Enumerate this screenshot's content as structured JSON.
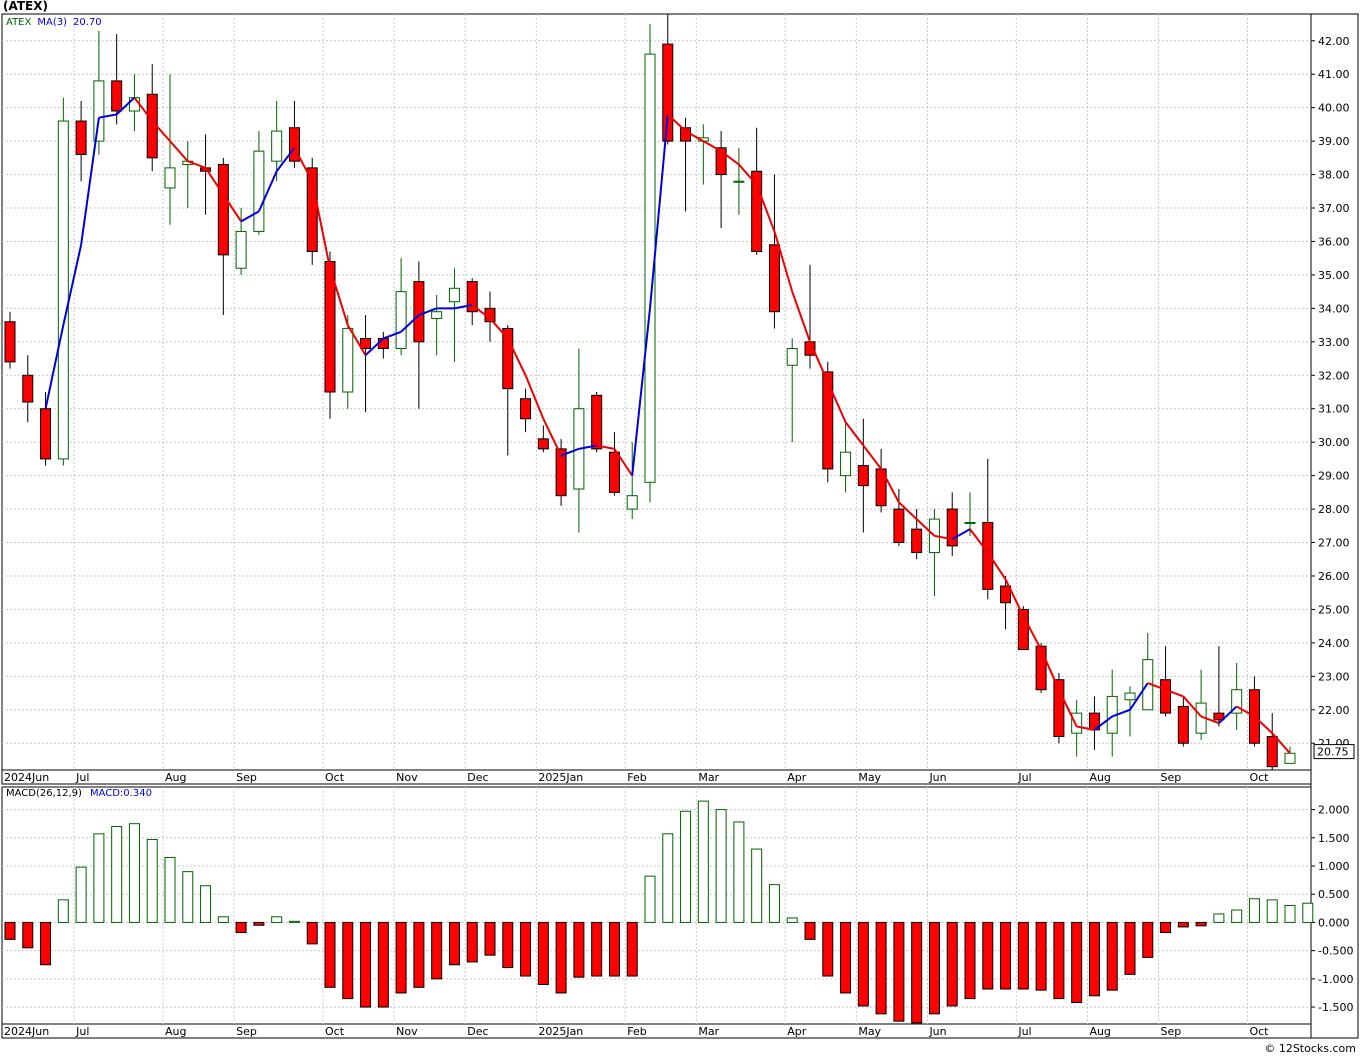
{
  "title": "(ATEX)",
  "footer": "© 12Stocks.com",
  "colors": {
    "up": "#006400",
    "down": "#ff0000",
    "ma_up": "#0000dd",
    "ma_down": "#ee0000",
    "grid": "#c8c8c8",
    "axis": "#000000"
  },
  "chart_data": [
    {
      "type": "candlestick",
      "legend": {
        "symbol": "ATEX",
        "ma_label": "MA(3)",
        "ma_value": "20.70"
      },
      "last_price": "20.75",
      "ylim": [
        20.2,
        42.8
      ],
      "y_ticks": [
        "42.00",
        "41.00",
        "40.00",
        "39.00",
        "38.00",
        "37.00",
        "36.00",
        "35.00",
        "34.00",
        "33.00",
        "32.00",
        "31.00",
        "30.00",
        "29.00",
        "28.00",
        "27.00",
        "26.00",
        "25.00",
        "24.00",
        "23.00",
        "22.00",
        "21.00"
      ],
      "x_labels": [
        "2024Jun",
        "Jul",
        "Aug",
        "Sep",
        "Oct",
        "Nov",
        "Dec",
        "2025Jan",
        "Feb",
        "Mar",
        "Apr",
        "May",
        "Jun",
        "Jul",
        "Aug",
        "Sep",
        "Oct"
      ],
      "x_label_index": [
        0,
        4,
        9,
        13,
        18,
        22,
        26,
        30,
        35,
        39,
        44,
        48,
        52,
        57,
        61,
        65,
        70
      ],
      "candles": [
        [
          33.6,
          33.9,
          32.2,
          32.4
        ],
        [
          32.0,
          32.6,
          30.6,
          31.2
        ],
        [
          31.0,
          31.5,
          29.3,
          29.5
        ],
        [
          29.5,
          40.3,
          29.3,
          39.6
        ],
        [
          39.6,
          40.2,
          37.8,
          38.6
        ],
        [
          39.0,
          42.3,
          38.6,
          40.8
        ],
        [
          40.8,
          42.2,
          39.5,
          39.9
        ],
        [
          39.9,
          41.0,
          39.3,
          40.3
        ],
        [
          40.4,
          41.3,
          38.1,
          38.5
        ],
        [
          37.6,
          41.0,
          36.5,
          38.2
        ],
        [
          38.3,
          39.0,
          37.0,
          38.4
        ],
        [
          38.2,
          39.2,
          36.8,
          38.1
        ],
        [
          38.3,
          38.5,
          33.8,
          35.6
        ],
        [
          35.2,
          37.0,
          35.0,
          36.3
        ],
        [
          36.3,
          39.3,
          36.2,
          38.7
        ],
        [
          38.4,
          40.2,
          37.8,
          39.3
        ],
        [
          39.4,
          40.2,
          38.2,
          38.4
        ],
        [
          38.2,
          38.5,
          35.3,
          35.7
        ],
        [
          35.4,
          35.7,
          30.7,
          31.5
        ],
        [
          31.5,
          33.8,
          31.0,
          33.4
        ],
        [
          33.1,
          33.8,
          30.9,
          32.8
        ],
        [
          33.1,
          33.3,
          32.5,
          32.8
        ],
        [
          32.8,
          35.5,
          32.6,
          34.5
        ],
        [
          34.8,
          35.4,
          31.0,
          33.0
        ],
        [
          33.7,
          34.4,
          32.6,
          33.9
        ],
        [
          34.2,
          35.2,
          32.4,
          34.6
        ],
        [
          34.8,
          34.9,
          33.5,
          33.9
        ],
        [
          34.0,
          34.5,
          33.0,
          33.6
        ],
        [
          33.4,
          33.5,
          29.6,
          31.6
        ],
        [
          31.3,
          31.6,
          30.3,
          30.7
        ],
        [
          30.1,
          30.5,
          29.7,
          29.8
        ],
        [
          29.8,
          30.1,
          28.1,
          28.4
        ],
        [
          28.6,
          32.8,
          27.3,
          31.0
        ],
        [
          31.4,
          31.5,
          29.7,
          29.8
        ],
        [
          29.7,
          30.3,
          28.4,
          28.5
        ],
        [
          28.0,
          30.0,
          27.7,
          28.4
        ],
        [
          28.8,
          42.5,
          28.2,
          41.6
        ],
        [
          41.9,
          42.8,
          38.9,
          39.0
        ],
        [
          39.4,
          39.7,
          36.9,
          39.0
        ],
        [
          39.0,
          39.5,
          37.7,
          39.1
        ],
        [
          38.8,
          39.3,
          36.4,
          38.0
        ],
        [
          37.8,
          38.8,
          36.8,
          37.8
        ],
        [
          38.1,
          39.4,
          35.6,
          35.7
        ],
        [
          35.9,
          38.0,
          33.4,
          33.9
        ],
        [
          32.3,
          33.1,
          30.0,
          32.8
        ],
        [
          33.0,
          35.3,
          32.2,
          32.6
        ],
        [
          32.1,
          32.4,
          28.8,
          29.2
        ],
        [
          29.0,
          30.6,
          28.5,
          29.7
        ],
        [
          29.3,
          30.7,
          27.3,
          28.7
        ],
        [
          29.2,
          29.8,
          27.9,
          28.1
        ],
        [
          28.0,
          28.6,
          26.9,
          27.0
        ],
        [
          27.4,
          28.0,
          26.5,
          26.7
        ],
        [
          26.7,
          28.0,
          25.4,
          27.7
        ],
        [
          28.0,
          28.5,
          26.6,
          26.9
        ],
        [
          27.6,
          28.5,
          27.2,
          27.6
        ],
        [
          27.6,
          29.5,
          25.3,
          25.6
        ],
        [
          25.7,
          26.0,
          24.4,
          25.2
        ],
        [
          25.0,
          25.1,
          23.9,
          23.8
        ],
        [
          23.9,
          24.0,
          22.5,
          22.6
        ],
        [
          22.9,
          23.1,
          21.0,
          21.2
        ],
        [
          21.3,
          22.3,
          20.6,
          21.9
        ],
        [
          21.9,
          22.4,
          20.8,
          21.4
        ],
        [
          21.3,
          23.2,
          20.6,
          22.4
        ],
        [
          22.3,
          22.7,
          21.2,
          22.5
        ],
        [
          22.0,
          24.3,
          22.1,
          23.5
        ],
        [
          22.9,
          23.9,
          21.8,
          21.9
        ],
        [
          22.1,
          22.4,
          20.9,
          21.0
        ],
        [
          21.3,
          23.2,
          21.1,
          22.2
        ],
        [
          21.9,
          23.9,
          21.5,
          21.7
        ],
        [
          21.9,
          23.4,
          21.4,
          22.6
        ],
        [
          22.6,
          23.0,
          20.9,
          21.0
        ],
        [
          21.2,
          21.9,
          20.2,
          20.3
        ],
        [
          20.4,
          20.9,
          20.4,
          20.7
        ]
      ],
      "ma": [
        null,
        null,
        31.0,
        33.5,
        35.9,
        39.7,
        39.8,
        40.3,
        39.6,
        39.0,
        38.4,
        38.2,
        37.4,
        36.6,
        36.9,
        38.1,
        38.8,
        37.8,
        35.2,
        33.5,
        32.6,
        33.1,
        33.3,
        33.8,
        34.0,
        34.0,
        34.1,
        33.7,
        33.1,
        32.0,
        30.7,
        29.6,
        29.8,
        29.9,
        29.8,
        29.0,
        34.0,
        39.8,
        39.3,
        39.0,
        38.7,
        38.3,
        37.7,
        36.3,
        34.5,
        33.0,
        31.8,
        30.6,
        29.9,
        29.2,
        28.2,
        27.7,
        27.2,
        27.1,
        27.4,
        26.7,
        25.9,
        24.8,
        23.8,
        22.6,
        21.5,
        21.4,
        21.8,
        22.0,
        22.8,
        22.6,
        22.4,
        21.8,
        21.6,
        22.1,
        21.8,
        21.3,
        20.7
      ]
    },
    {
      "type": "bar",
      "legend": {
        "name": "MACD(26,12,9)",
        "value_label": "MACD:0.340"
      },
      "ylim": [
        -1.8,
        2.4
      ],
      "y_ticks": [
        "2.000",
        "1.500",
        "1.000",
        "0.500",
        "0.000",
        "-0.500",
        "-1.000",
        "-1.500"
      ],
      "x_labels": [
        "2024Jun",
        "Jul",
        "Aug",
        "Sep",
        "Oct",
        "Nov",
        "Dec",
        "2025Jan",
        "Feb",
        "Mar",
        "Apr",
        "May",
        "Jun",
        "Jul",
        "Aug",
        "Sep",
        "Oct"
      ],
      "values": [
        -0.3,
        -0.45,
        -0.75,
        0.4,
        0.98,
        1.57,
        1.7,
        1.75,
        1.47,
        1.15,
        0.9,
        0.65,
        0.1,
        -0.18,
        -0.05,
        0.1,
        0.02,
        -0.38,
        -1.15,
        -1.35,
        -1.5,
        -1.5,
        -1.25,
        -1.15,
        -1.0,
        -0.75,
        -0.7,
        -0.58,
        -0.8,
        -0.95,
        -1.1,
        -1.25,
        -0.97,
        -0.95,
        -0.95,
        -0.95,
        0.82,
        1.57,
        1.97,
        2.15,
        2.0,
        1.78,
        1.3,
        0.67,
        0.08,
        -0.3,
        -0.95,
        -1.25,
        -1.48,
        -1.62,
        -1.75,
        -1.78,
        -1.62,
        -1.48,
        -1.35,
        -1.18,
        -1.18,
        -1.18,
        -1.2,
        -1.35,
        -1.42,
        -1.3,
        -1.2,
        -0.92,
        -0.62,
        -0.18,
        -0.08,
        -0.06,
        0.15,
        0.22,
        0.42,
        0.4,
        0.3,
        0.34
      ]
    }
  ]
}
